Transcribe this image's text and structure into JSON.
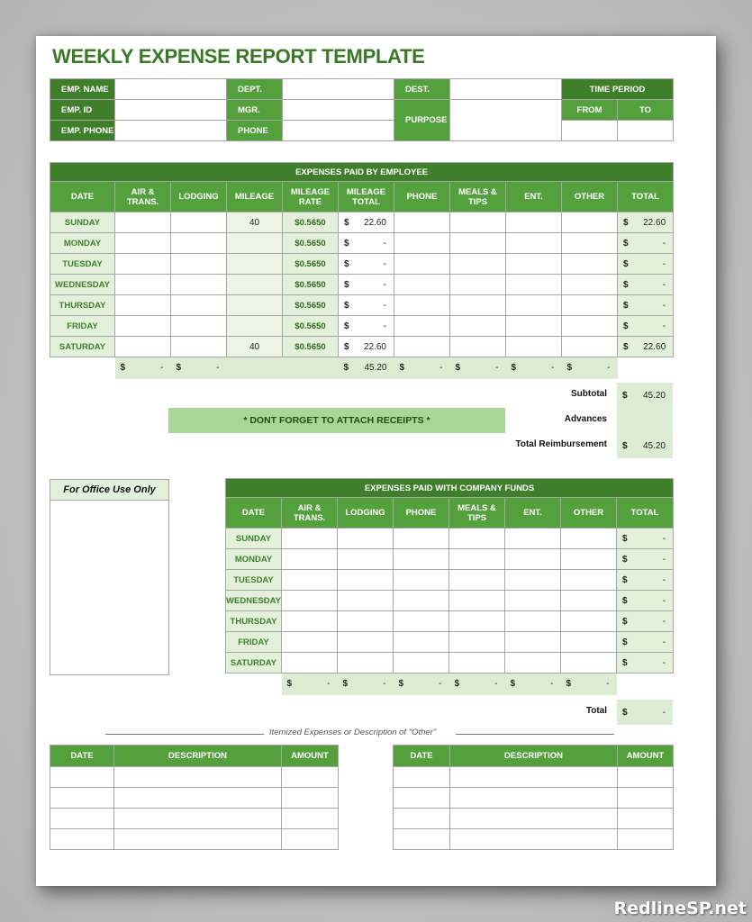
{
  "title": "WEEKLY EXPENSE REPORT TEMPLATE",
  "header": {
    "emp_name_label": "EMP. NAME",
    "emp_id_label": "EMP. ID",
    "emp_phone_label": "EMP. PHONE",
    "dept_label": "DEPT.",
    "mgr_label": "MGR.",
    "phone_label": "PHONE",
    "dest_label": "DEST.",
    "purpose_label": "PURPOSE",
    "time_period_label": "TIME PERIOD",
    "from_label": "FROM",
    "to_label": "TO",
    "emp_name": "",
    "emp_id": "",
    "emp_phone": "",
    "dept": "",
    "mgr": "",
    "phone": "",
    "dest": "",
    "purpose": "",
    "from": "",
    "to": ""
  },
  "employee_expenses": {
    "title": "EXPENSES PAID BY EMPLOYEE",
    "columns": [
      "DATE",
      "AIR & TRANS.",
      "LODGING",
      "MILEAGE",
      "MILEAGE RATE",
      "MILEAGE TOTAL",
      "PHONE",
      "MEALS & TIPS",
      "ENT.",
      "OTHER",
      "TOTAL"
    ],
    "rows": [
      {
        "day": "SUNDAY",
        "air": "",
        "lodging": "",
        "mileage": "40",
        "rate": "$0.5650",
        "mileage_total": "22.60",
        "phone": "",
        "meals": "",
        "ent": "",
        "other": "",
        "total": "22.60"
      },
      {
        "day": "MONDAY",
        "air": "",
        "lodging": "",
        "mileage": "",
        "rate": "$0.5650",
        "mileage_total": "-",
        "phone": "",
        "meals": "",
        "ent": "",
        "other": "",
        "total": "-"
      },
      {
        "day": "TUESDAY",
        "air": "",
        "lodging": "",
        "mileage": "",
        "rate": "$0.5650",
        "mileage_total": "-",
        "phone": "",
        "meals": "",
        "ent": "",
        "other": "",
        "total": "-"
      },
      {
        "day": "WEDNESDAY",
        "air": "",
        "lodging": "",
        "mileage": "",
        "rate": "$0.5650",
        "mileage_total": "-",
        "phone": "",
        "meals": "",
        "ent": "",
        "other": "",
        "total": "-"
      },
      {
        "day": "THURSDAY",
        "air": "",
        "lodging": "",
        "mileage": "",
        "rate": "$0.5650",
        "mileage_total": "-",
        "phone": "",
        "meals": "",
        "ent": "",
        "other": "",
        "total": "-"
      },
      {
        "day": "FRIDAY",
        "air": "",
        "lodging": "",
        "mileage": "",
        "rate": "$0.5650",
        "mileage_total": "-",
        "phone": "",
        "meals": "",
        "ent": "",
        "other": "",
        "total": "-"
      },
      {
        "day": "SATURDAY",
        "air": "",
        "lodging": "",
        "mileage": "40",
        "rate": "$0.5650",
        "mileage_total": "22.60",
        "phone": "",
        "meals": "",
        "ent": "",
        "other": "",
        "total": "22.60"
      }
    ],
    "column_sums": {
      "air": "-",
      "lodging": "-",
      "mileage_total": "45.20",
      "phone": "-",
      "meals": "-",
      "ent": "-",
      "other": "-"
    },
    "currency": "$",
    "subtotal_label": "Subtotal",
    "subtotal": "45.20",
    "advances_label": "Advances",
    "advances": "",
    "total_reimbursement_label": "Total Reimbursement",
    "total_reimbursement": "45.20",
    "note": "* DONT FORGET TO ATTACH RECEIPTS *"
  },
  "office_use": {
    "label": "For Office Use Only"
  },
  "company_expenses": {
    "title": "EXPENSES PAID WITH COMPANY FUNDS",
    "columns": [
      "DATE",
      "AIR & TRANS.",
      "LODGING",
      "PHONE",
      "MEALS & TIPS",
      "ENT.",
      "OTHER",
      "TOTAL"
    ],
    "rows": [
      {
        "day": "SUNDAY",
        "total": "-"
      },
      {
        "day": "MONDAY",
        "total": "-"
      },
      {
        "day": "TUESDAY",
        "total": "-"
      },
      {
        "day": "WEDNESDAY",
        "total": "-"
      },
      {
        "day": "THURSDAY",
        "total": "-"
      },
      {
        "day": "FRIDAY",
        "total": "-"
      },
      {
        "day": "SATURDAY",
        "total": "-"
      }
    ],
    "column_sums": [
      "-",
      "-",
      "-",
      "-",
      "-",
      "-"
    ],
    "total_label": "Total",
    "total": "-"
  },
  "itemized": {
    "caption": "Itemized Expenses or Description of \"Other\"",
    "columns": [
      "DATE",
      "DESCRIPTION",
      "AMOUNT"
    ],
    "left_rows": 4,
    "right_rows": 4
  },
  "watermark": "RedlineSP.net"
}
